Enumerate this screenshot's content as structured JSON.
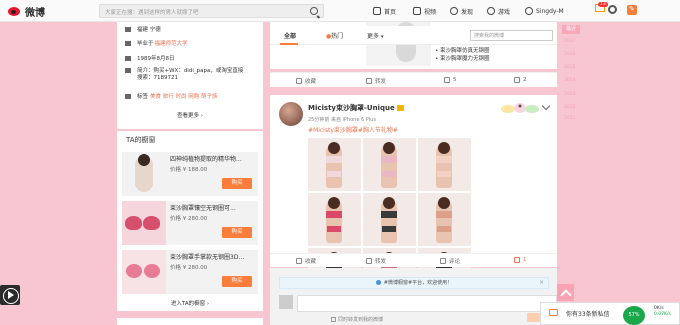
{
  "header": {
    "brand": "微博",
    "search_placeholder": "大家正在搜：遇到这样的男人就嫁了吧",
    "nav": [
      {
        "label": "首页",
        "icon": "home-icon"
      },
      {
        "label": "视频",
        "icon": "video-icon"
      },
      {
        "label": "发现",
        "icon": "discover-icon"
      },
      {
        "label": "游戏",
        "icon": "game-icon"
      }
    ],
    "username": "Singdy-M",
    "notif_count": "13"
  },
  "profile": {
    "location": "福建 宁德",
    "school_prefix": "毕业于",
    "school": "福建师范大学",
    "birthday": "1989年8月8日",
    "intro_line1": "简介：购买+WX：didi_papa，或淘宝直接",
    "intro_line2": "搜索：7189721",
    "tags_label": "标签",
    "tags": "美食 旅行 时尚 网购 萌子族",
    "see_more": "查看更多 ›"
  },
  "shop": {
    "title": "TA的橱窗",
    "items": [
      {
        "name": "四神纯植物提取的精华物...",
        "price": "价格 ¥ 188.00",
        "buy": "购买"
      },
      {
        "name": "束沙胸罩镶空无钢圈可...",
        "price": "价格 ¥ 280.00",
        "buy": "购买"
      },
      {
        "name": "束沙胸罩手掌款无钢圈3D...",
        "price": "价格 ¥ 280.00",
        "buy": "购买"
      }
    ],
    "enter": "进入TA的橱窗 ›"
  },
  "feed": {
    "tabs": [
      "全部",
      "热门",
      "更多"
    ],
    "search_placeholder": "搜索我的微博",
    "prev_lines": [
      "• 束沙胸罩仿真无钢圈",
      "• 束沙胸罩魔力无钢圈"
    ],
    "prev_actions": {
      "fav": "收藏",
      "repost": "转发",
      "comment": "5",
      "like": "2"
    },
    "post": {
      "author": "Micisty束沙胸罩-Unique",
      "meta": "25分钟前 来自 iPhone 6 Plus",
      "text": "#Micisty束沙胸罩#胸人节礼物#",
      "actions": {
        "fav": "收藏",
        "repost": "转发",
        "comment": "评论",
        "like": "1"
      }
    },
    "notice": "#微博橱窗#平台，欢迎使用！",
    "comment_sync": "同时转发到我的微博"
  },
  "timeline": {
    "tag": "最近",
    "years": [
      "2017",
      "2016",
      "2015",
      "2014",
      "2013",
      "2012",
      "2011"
    ]
  },
  "chat": {
    "text": "你有33条新私信"
  },
  "speed": {
    "percent": "57%",
    "up": "0K/s",
    "down": "0.07K/s"
  },
  "colors": {
    "accent": "#fa7d3c",
    "brand": "#e6162d",
    "page_bg": "#f7c6d0"
  }
}
